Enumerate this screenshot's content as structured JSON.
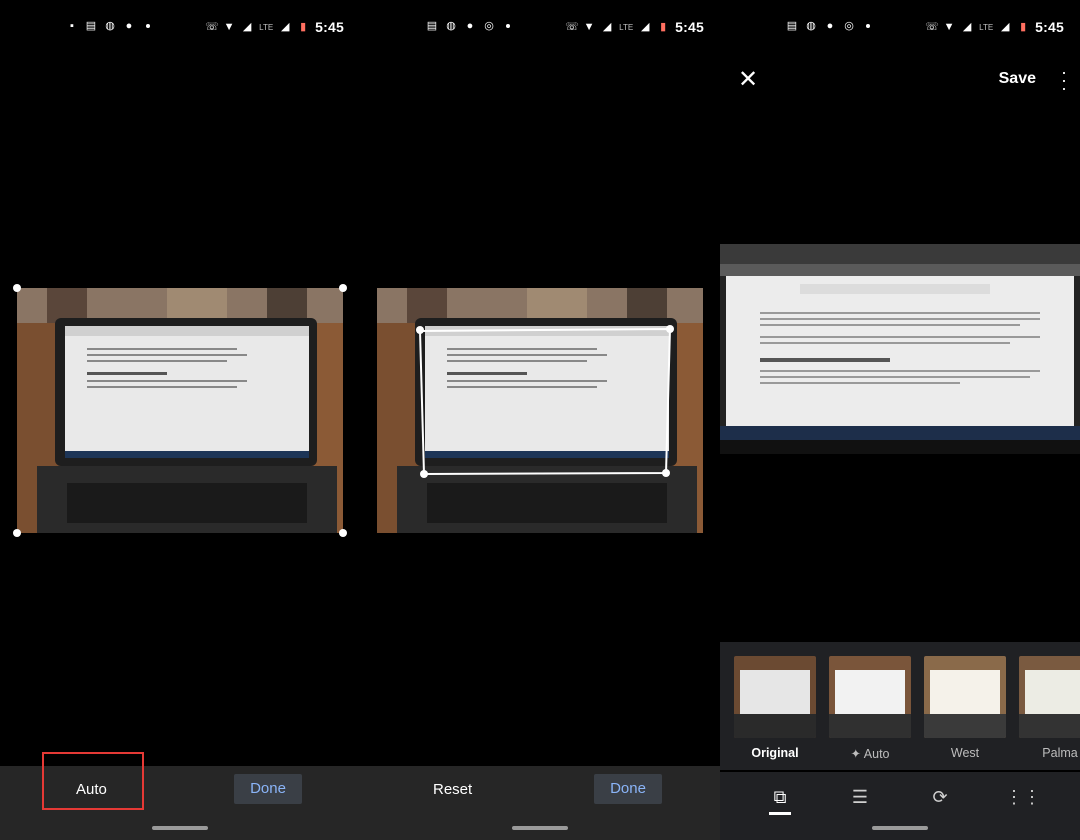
{
  "status": {
    "time": "5:45",
    "left_icons": {
      "p1": [
        "image-icon",
        "message-icon",
        "whatsapp-icon",
        "facebook-icon"
      ],
      "p2": [
        "message-icon",
        "whatsapp-icon",
        "facebook-icon",
        "instagram-icon"
      ],
      "p3": [
        "message-icon",
        "whatsapp-icon",
        "facebook-icon",
        "instagram-icon"
      ]
    },
    "lte": "LTE"
  },
  "panel1": {
    "auto_label": "Auto",
    "done_label": "Done"
  },
  "panel2": {
    "reset_label": "Reset",
    "done_label": "Done"
  },
  "panel3": {
    "save_label": "Save",
    "filters": [
      {
        "label": "Original"
      },
      {
        "label": "Auto",
        "prefix": "✦"
      },
      {
        "label": "West"
      },
      {
        "label": "Palma"
      }
    ],
    "tools": [
      "crop-rotate-icon",
      "adjust-sliders-icon",
      "rotate-icon",
      "grid-icon"
    ]
  },
  "colors": {
    "accent": "#8ab4f8",
    "bar": "#262626",
    "tray": "#202124",
    "highlight": "#e53935"
  }
}
